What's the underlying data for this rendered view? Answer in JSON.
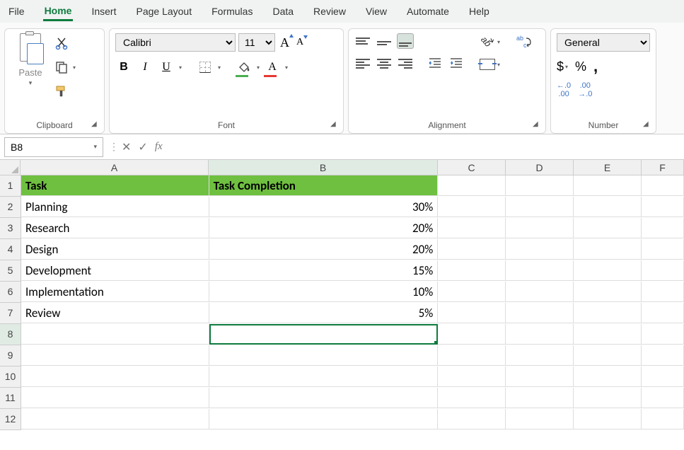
{
  "menu": {
    "items": [
      "File",
      "Home",
      "Insert",
      "Page Layout",
      "Formulas",
      "Data",
      "Review",
      "View",
      "Automate",
      "Help"
    ],
    "active": "Home"
  },
  "ribbon": {
    "clipboard": {
      "label": "Clipboard",
      "paste": "Paste"
    },
    "font": {
      "label": "Font",
      "font_name": "Calibri",
      "font_size": "11",
      "b": "B",
      "i": "I",
      "u": "U",
      "a_big": "A",
      "a_small": "A",
      "a_color": "A"
    },
    "alignment": {
      "label": "Alignment",
      "orient": "ab"
    },
    "number": {
      "label": "Number",
      "format": "General",
      "dollar": "$",
      "percent": "%",
      "comma": ",",
      "inc_dec": ".0",
      "inc_dec2": ".00",
      "dec_dec": ".00",
      "dec_dec2": ".0"
    }
  },
  "formula_bar": {
    "name_box": "B8",
    "formula": "",
    "fx": "fx",
    "cancel": "✕",
    "enter": "✓"
  },
  "sheet": {
    "columns": [
      "A",
      "B",
      "C",
      "D",
      "E",
      "F"
    ],
    "row_numbers": [
      "1",
      "2",
      "3",
      "4",
      "5",
      "6",
      "7",
      "8",
      "9",
      "10",
      "11",
      "12"
    ],
    "header_row": {
      "A": "Task",
      "B": "Task Completion"
    },
    "data": [
      {
        "A": "Planning",
        "B": "30%"
      },
      {
        "A": "Research",
        "B": "20%"
      },
      {
        "A": "Design",
        "B": "20%"
      },
      {
        "A": "Development",
        "B": "15%"
      },
      {
        "A": "Implementation",
        "B": "10%"
      },
      {
        "A": "Review",
        "B": "5%"
      }
    ],
    "selected": "B8"
  },
  "chart_data": {
    "type": "table",
    "title": "Task Completion",
    "categories": [
      "Planning",
      "Research",
      "Design",
      "Development",
      "Implementation",
      "Review"
    ],
    "values": [
      30,
      20,
      20,
      15,
      10,
      5
    ],
    "xlabel": "Task",
    "ylabel": "Task Completion (%)",
    "ylim": [
      0,
      100
    ]
  }
}
